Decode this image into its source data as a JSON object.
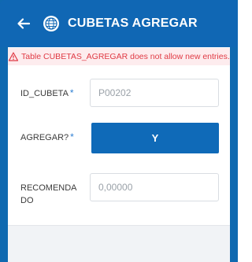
{
  "header": {
    "title": "CUBETAS AGREGAR",
    "back_icon": "arrow-left-icon",
    "logo_icon": "globe-logo-icon",
    "color": "#1067b4"
  },
  "error": {
    "message": "Table CUBETAS_AGREGAR does not allow new entries.",
    "icon": "warning-triangle-icon",
    "color": "#e03a44"
  },
  "form": {
    "id_cubeta": {
      "label": "ID_CUBETA",
      "required_mark": "*",
      "value": "P00202"
    },
    "agregar": {
      "label": "AGREGAR?",
      "required_mark": "*",
      "button_label": "Y"
    },
    "recomendado": {
      "label": "RECOMENDA DO",
      "value": "0,00000"
    }
  }
}
